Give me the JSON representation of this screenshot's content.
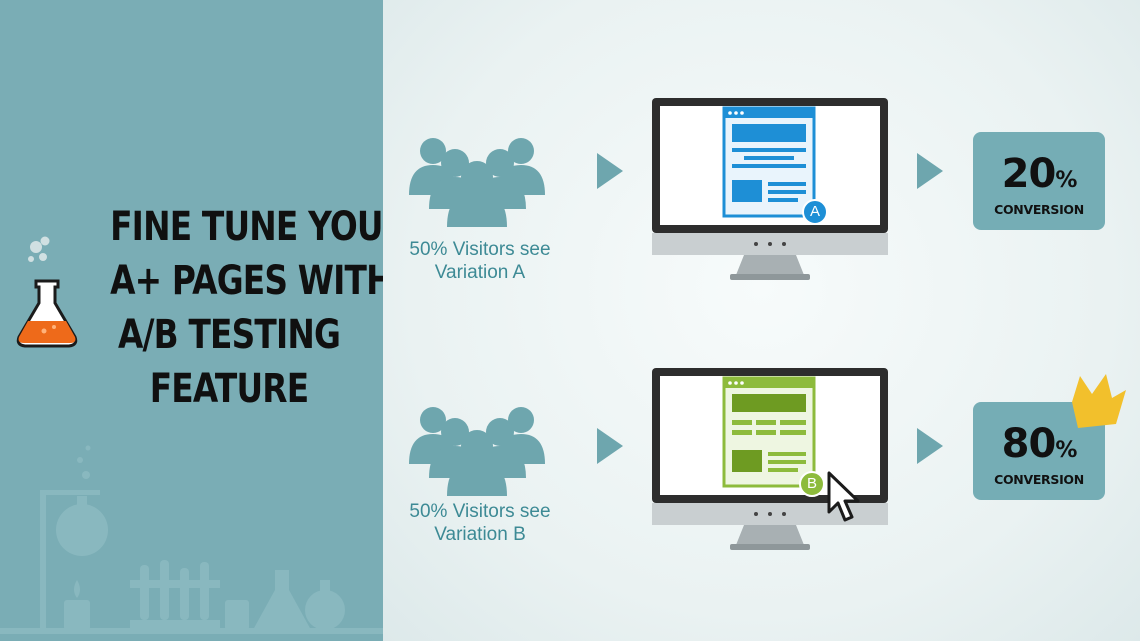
{
  "headline": {
    "lines": [
      "FINE TUNE YOUR",
      "A+ PAGES WITH",
      "A/B TESTING",
      "FEATURE"
    ]
  },
  "variation_a": {
    "caption_line1": "50% Visitors see",
    "caption_line2": "Variation A",
    "marker": "A",
    "rate": "20",
    "percent_sign": "%",
    "rate_label": "CONVERSION",
    "accent_color": "#1e8fd6"
  },
  "variation_b": {
    "caption_line1": "50% Visitors see",
    "caption_line2": "Variation B",
    "marker": "B",
    "rate": "80",
    "percent_sign": "%",
    "rate_label": "CONVERSION",
    "accent_color": "#8dbb3c"
  },
  "colors": {
    "left_panel": "#7aadb5",
    "people": "#6ea6ae",
    "arrow": "#6ea6ae",
    "badge": "#75adb5",
    "caption": "#3d8a95",
    "flask_liquid": "#ee6a1a",
    "crown": "#f2c02c"
  },
  "icons": [
    "flask-icon",
    "people-group-icon",
    "arrow-right-icon",
    "monitor-icon",
    "crown-icon",
    "mouse-cursor-icon"
  ]
}
